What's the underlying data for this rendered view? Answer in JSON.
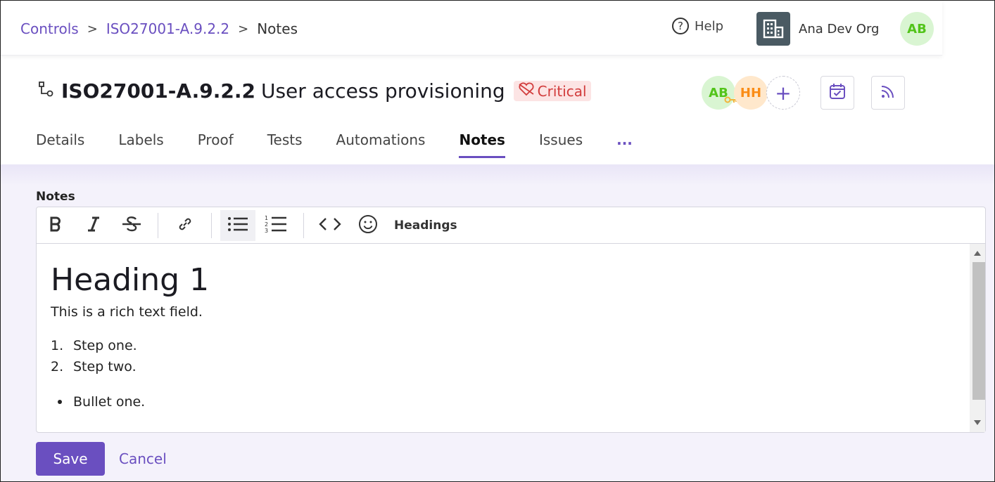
{
  "breadcrumb": {
    "root": "Controls",
    "control": "ISO27001-A.9.2.2",
    "current": "Notes",
    "separator": ">"
  },
  "header": {
    "help_label": "Help",
    "help_icon": "question-circle-icon",
    "org_name": "Ana Dev Org",
    "org_icon": "building-icon",
    "user_initials": "AB"
  },
  "control": {
    "id": "ISO27001-A.9.2.2",
    "name": "User access provisioning",
    "badge": "Critical",
    "badge_color": "#d23c3c",
    "owners": [
      {
        "initials": "AB",
        "color": "#52c41a"
      },
      {
        "initials": "HH",
        "color": "#fa8c16"
      }
    ],
    "add_owner_label": "+"
  },
  "tabs": [
    {
      "label": "Details"
    },
    {
      "label": "Labels"
    },
    {
      "label": "Proof"
    },
    {
      "label": "Tests"
    },
    {
      "label": "Automations"
    },
    {
      "label": "Notes",
      "active": true
    },
    {
      "label": "Issues"
    },
    {
      "label": "..."
    }
  ],
  "notes": {
    "label": "Notes",
    "toolbar": {
      "headings_label": "Headings",
      "items": [
        "bold-icon",
        "italic-icon",
        "strikethrough-icon",
        "link-icon",
        "bullet-list-icon",
        "numbered-list-icon",
        "code-icon",
        "emoji-icon"
      ]
    },
    "content": {
      "heading": "Heading 1",
      "paragraph": "This is a rich text field.",
      "ordered": [
        {
          "num": "1.",
          "text": "Step one."
        },
        {
          "num": "2.",
          "text": "Step two."
        }
      ],
      "bullets": [
        "Bullet one."
      ]
    }
  },
  "actions": {
    "save_label": "Save",
    "cancel_label": "Cancel"
  },
  "colors": {
    "accent": "#6a4fc0"
  }
}
